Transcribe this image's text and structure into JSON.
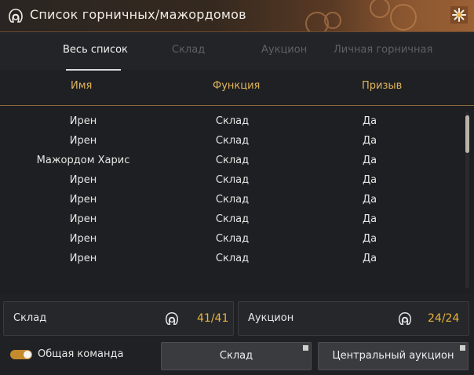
{
  "window": {
    "title": "Список горничных/мажордомов"
  },
  "tabs": [
    {
      "label": "Весь список"
    },
    {
      "label": "Склад"
    },
    {
      "label": "Аукцион"
    },
    {
      "label": "Личная горничная"
    }
  ],
  "columns": {
    "name": "Имя",
    "function": "Функция",
    "summon": "Призыв"
  },
  "rows": [
    {
      "name": "Ирен",
      "function": "Склад",
      "summon": "Да"
    },
    {
      "name": "Ирен",
      "function": "Склад",
      "summon": "Да"
    },
    {
      "name": "Мажордом Харис",
      "function": "Склад",
      "summon": "Да"
    },
    {
      "name": "Ирен",
      "function": "Склад",
      "summon": "Да"
    },
    {
      "name": "Ирен",
      "function": "Склад",
      "summon": "Да"
    },
    {
      "name": "Ирен",
      "function": "Склад",
      "summon": "Да"
    },
    {
      "name": "Ирен",
      "function": "Склад",
      "summon": "Да"
    },
    {
      "name": "Ирен",
      "function": "Склад",
      "summon": "Да"
    }
  ],
  "counters": {
    "warehouse": {
      "label": "Склад",
      "value": "41/41"
    },
    "auction": {
      "label": "Аукцион",
      "value": "24/24"
    }
  },
  "footer": {
    "toggle_label": "Общая команда",
    "toggle_on": true,
    "warehouse_button": "Склад",
    "auction_button": "Центральный аукцион"
  },
  "colors": {
    "accent": "#e8b43c",
    "header_gold": "#e0b45c",
    "toggle": "#c58a2c"
  },
  "icons": {
    "title": "maid-icon",
    "close": "flower-close-icon",
    "counter": "maid-icon"
  }
}
